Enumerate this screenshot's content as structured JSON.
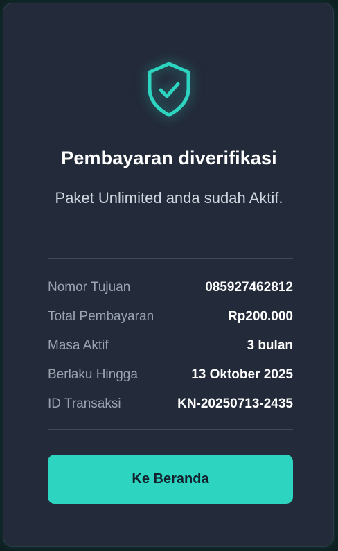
{
  "status": {
    "icon": "shield-check-icon",
    "title": "Pembayaran diverifikasi",
    "message": "Paket Unlimited anda sudah Aktif."
  },
  "details": [
    {
      "label": "Nomor Tujuan",
      "value": "085927462812"
    },
    {
      "label": "Total Pembayaran",
      "value": "Rp200.000"
    },
    {
      "label": "Masa Aktif",
      "value": "3 bulan"
    },
    {
      "label": "Berlaku Hingga",
      "value": "13 Oktober 2025"
    },
    {
      "label": "ID Transaksi",
      "value": "KN-20250713-2435"
    }
  ],
  "actions": {
    "home_label": "Ke Beranda"
  },
  "colors": {
    "accent": "#2dd4bf",
    "card_background": "#232b3a",
    "page_background": "#0f1f22"
  }
}
